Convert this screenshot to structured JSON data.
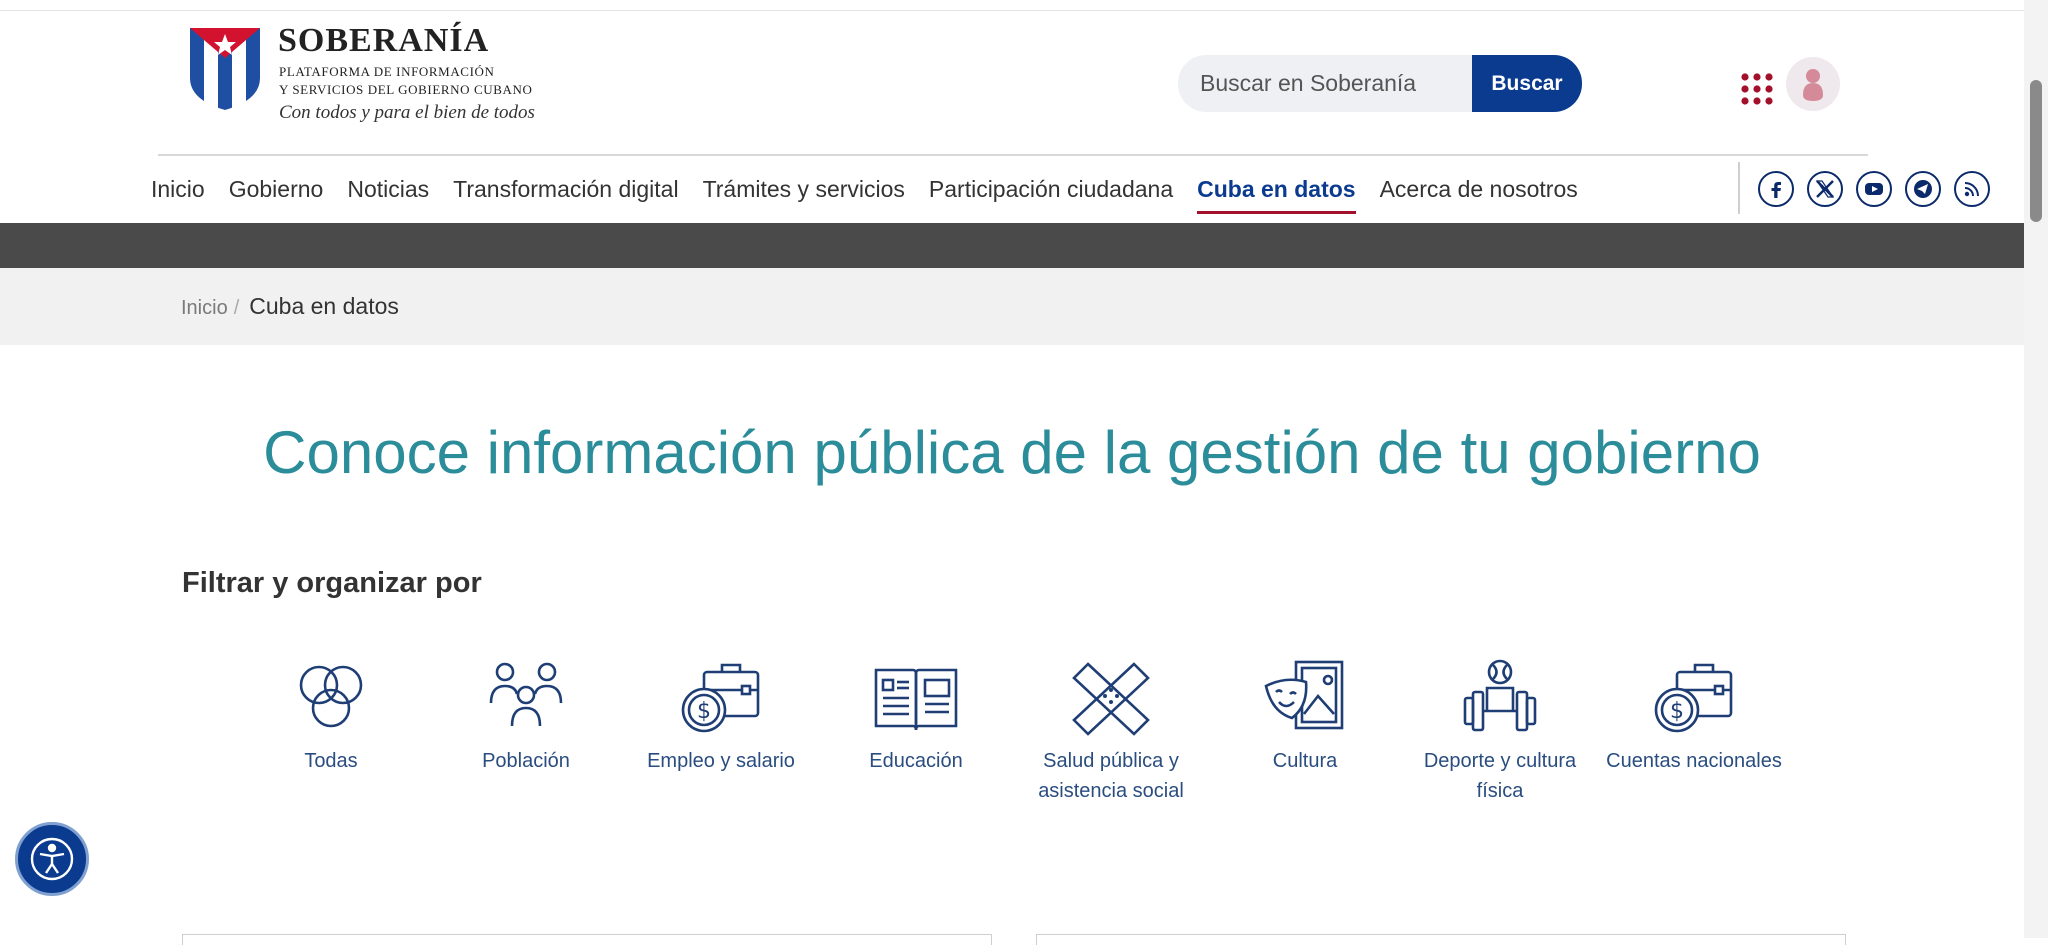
{
  "logo": {
    "title": "SOBERANÍA",
    "subtitle_line1": "PLATAFORMA DE INFORMACIÓN",
    "subtitle_line2": "Y SERVICIOS DEL GOBIERNO CUBANO",
    "motto": "Con todos y para el bien de todos"
  },
  "search": {
    "placeholder": "Buscar en Soberanía",
    "button_label": "Buscar"
  },
  "nav": {
    "items": [
      {
        "label": "Inicio"
      },
      {
        "label": "Gobierno"
      },
      {
        "label": "Noticias"
      },
      {
        "label": "Transformación digital"
      },
      {
        "label": "Trámites y servicios"
      },
      {
        "label": "Participación ciudadana"
      },
      {
        "label": "Cuba en datos",
        "active": true
      },
      {
        "label": "Acerca de nosotros"
      }
    ]
  },
  "social": [
    "facebook-icon",
    "x-icon",
    "youtube-icon",
    "telegram-icon",
    "rss-icon"
  ],
  "breadcrumb": {
    "home": "Inicio",
    "separator": "/",
    "current": "Cuba en datos"
  },
  "headline": "Conoce información pública de la gestión de tu gobierno",
  "filter": {
    "title": "Filtrar y organizar por",
    "categories": [
      {
        "label": "Todas",
        "icon": "circles-icon"
      },
      {
        "label": "Población",
        "icon": "people-icon"
      },
      {
        "label": "Empleo y salario",
        "icon": "briefcase-money-icon"
      },
      {
        "label": "Educación",
        "icon": "book-icon"
      },
      {
        "label": "Salud pública y asistencia social",
        "icon": "bandage-icon"
      },
      {
        "label": "Cultura",
        "icon": "theater-masks-icon"
      },
      {
        "label": "Deporte y cultura física",
        "icon": "dumbbell-icon"
      },
      {
        "label": "Cuentas nacionales",
        "icon": "briefcase-money-icon"
      }
    ]
  },
  "colors": {
    "primary_blue": "#0b3b8f",
    "accent_red": "#a3102c",
    "headline_teal": "#2b8c9a",
    "dark_bar": "#4a4a4a"
  }
}
